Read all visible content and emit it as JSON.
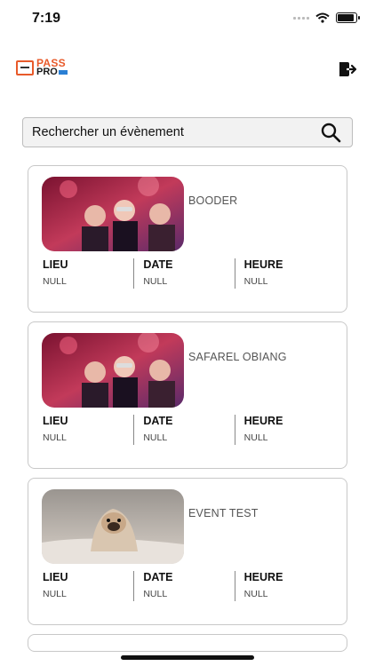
{
  "status_bar": {
    "time": "7:19"
  },
  "header": {
    "logo": {
      "line1": "PASS",
      "line2": "PRO"
    },
    "logout_icon": "logout-icon"
  },
  "search": {
    "placeholder": "Rechercher un évènement",
    "icon": "search-icon"
  },
  "events": [
    {
      "name": "BOODER",
      "image": "party-photo",
      "lieu_label": "LIEU",
      "lieu": "NULL",
      "date_label": "DATE",
      "date": "NULL",
      "heure_label": "HEURE",
      "heure": "NULL"
    },
    {
      "name": "SAFAREL OBIANG",
      "image": "party-photo",
      "lieu_label": "LIEU",
      "lieu": "NULL",
      "date_label": "DATE",
      "date": "NULL",
      "heure_label": "HEURE",
      "heure": "NULL"
    },
    {
      "name": "EVENT TEST",
      "image": "dog-photo",
      "lieu_label": "LIEU",
      "lieu": "NULL",
      "date_label": "DATE",
      "date": "NULL",
      "heure_label": "HEURE",
      "heure": "NULL"
    }
  ],
  "colors": {
    "brand_orange": "#e85a2a",
    "card_border": "#c8c8c8"
  }
}
